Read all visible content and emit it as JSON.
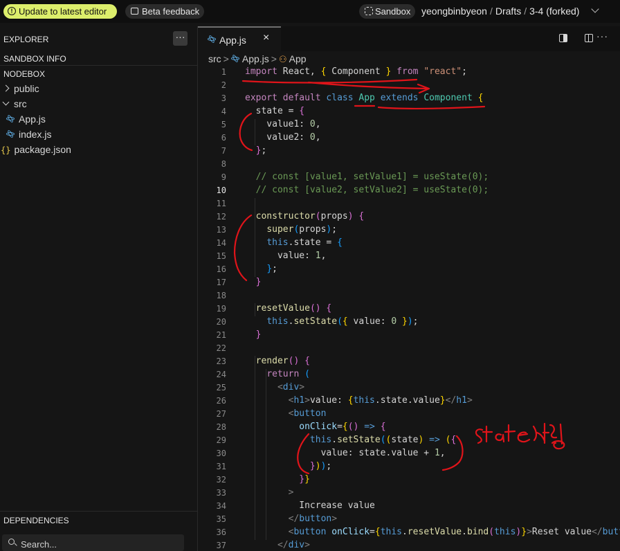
{
  "topbar": {
    "update_label": "Update to latest editor",
    "feedback_label": "Beta feedback",
    "sandbox_label": "Sandbox",
    "owner": "yeongbinbyeon",
    "folder": "Drafts",
    "project": "3-4 (forked)",
    "sep": "/"
  },
  "sidebar": {
    "explorer": "EXPLORER",
    "menu_dots": "···",
    "sandbox_info": "SANDBOX INFO",
    "nodebox": "NODEBOX",
    "tree": {
      "public": "public",
      "src": "src",
      "app": "App.js",
      "index": "index.js",
      "package": "package.json"
    },
    "json_icon": "{}",
    "dependencies": "DEPENDENCIES",
    "search_placeholder": "Search..."
  },
  "editor": {
    "tab_name": "App.js",
    "tab_close": "×",
    "more_dots": "···",
    "breadcrumb": {
      "src": "src",
      "file": "App.js",
      "symbol": "App",
      "sep": ">"
    },
    "active_line": 10,
    "lines": [
      [
        [
          "import",
          "#c586c0"
        ],
        [
          " React, ",
          null
        ],
        [
          "{",
          "#ffd700"
        ],
        [
          " Component ",
          null
        ],
        [
          "}",
          "#ffd700"
        ],
        [
          " ",
          null
        ],
        [
          "from",
          "#c586c0"
        ],
        [
          " ",
          null
        ],
        [
          "\"react\"",
          "#ce9178"
        ],
        [
          ";",
          null
        ]
      ],
      [],
      [
        [
          "export",
          "#c586c0"
        ],
        [
          " ",
          null
        ],
        [
          "default",
          "#c586c0"
        ],
        [
          " ",
          null
        ],
        [
          "class",
          "#569cd6"
        ],
        [
          " ",
          null
        ],
        [
          "App",
          "#4ec9b0"
        ],
        [
          " ",
          null
        ],
        [
          "extends",
          "#569cd6"
        ],
        [
          " ",
          null
        ],
        [
          "Component",
          "#4ec9b0"
        ],
        [
          " ",
          null
        ],
        [
          "{",
          "#ffd700"
        ]
      ],
      [
        [
          "  state = ",
          null
        ],
        [
          "{",
          "#da70d6"
        ]
      ],
      [
        [
          "    value1: ",
          null
        ],
        [
          "0",
          "#b5cea8"
        ],
        [
          ",",
          null
        ]
      ],
      [
        [
          "    value2: ",
          null
        ],
        [
          "0",
          "#b5cea8"
        ],
        [
          ",",
          null
        ]
      ],
      [
        [
          "  ",
          null
        ],
        [
          "}",
          "#da70d6"
        ],
        [
          ";",
          null
        ]
      ],
      [],
      [
        [
          "  // const [value1, setValue1] = useState(0);",
          "#6a9955"
        ]
      ],
      [
        [
          "  // const [value2, setValue2] = useState(0);",
          "#6a9955"
        ]
      ],
      [],
      [
        [
          "  ",
          null
        ],
        [
          "constructor",
          "#dcdcaa"
        ],
        [
          "(",
          "#da70d6"
        ],
        [
          "props",
          null
        ],
        [
          ")",
          "#da70d6"
        ],
        [
          " ",
          null
        ],
        [
          "{",
          "#da70d6"
        ]
      ],
      [
        [
          "    ",
          null
        ],
        [
          "super",
          "#dcdcaa"
        ],
        [
          "(",
          "#179fff"
        ],
        [
          "props",
          null
        ],
        [
          ")",
          "#179fff"
        ],
        [
          ";",
          null
        ]
      ],
      [
        [
          "    ",
          null
        ],
        [
          "this",
          "#569cd6"
        ],
        [
          ".state = ",
          null
        ],
        [
          "{",
          "#179fff"
        ]
      ],
      [
        [
          "      value: ",
          null
        ],
        [
          "1",
          "#b5cea8"
        ],
        [
          ",",
          null
        ]
      ],
      [
        [
          "    ",
          null
        ],
        [
          "}",
          "#179fff"
        ],
        [
          ";",
          null
        ]
      ],
      [
        [
          "  ",
          null
        ],
        [
          "}",
          "#da70d6"
        ]
      ],
      [],
      [
        [
          "  ",
          null
        ],
        [
          "resetValue",
          "#dcdcaa"
        ],
        [
          "()",
          "#da70d6"
        ],
        [
          " ",
          null
        ],
        [
          "{",
          "#da70d6"
        ]
      ],
      [
        [
          "    ",
          null
        ],
        [
          "this",
          "#569cd6"
        ],
        [
          ".",
          null
        ],
        [
          "setState",
          "#dcdcaa"
        ],
        [
          "(",
          "#179fff"
        ],
        [
          "{",
          "#ffd700"
        ],
        [
          " value: ",
          null
        ],
        [
          "0",
          "#b5cea8"
        ],
        [
          " ",
          null
        ],
        [
          "}",
          "#ffd700"
        ],
        [
          ")",
          "#179fff"
        ],
        [
          ";",
          null
        ]
      ],
      [
        [
          "  ",
          null
        ],
        [
          "}",
          "#da70d6"
        ]
      ],
      [],
      [
        [
          "  ",
          null
        ],
        [
          "render",
          "#dcdcaa"
        ],
        [
          "()",
          "#da70d6"
        ],
        [
          " ",
          null
        ],
        [
          "{",
          "#da70d6"
        ]
      ],
      [
        [
          "    ",
          null
        ],
        [
          "return",
          "#c586c0"
        ],
        [
          " ",
          null
        ],
        [
          "(",
          "#179fff"
        ]
      ],
      [
        [
          "      ",
          null
        ],
        [
          "<",
          "#808080"
        ],
        [
          "div",
          "#569cd6"
        ],
        [
          ">",
          "#808080"
        ]
      ],
      [
        [
          "        ",
          null
        ],
        [
          "<",
          "#808080"
        ],
        [
          "h1",
          "#569cd6"
        ],
        [
          ">",
          "#808080"
        ],
        [
          "value: ",
          null
        ],
        [
          "{",
          "#ffd700"
        ],
        [
          "this",
          "#569cd6"
        ],
        [
          ".state.value",
          null
        ],
        [
          "}",
          "#ffd700"
        ],
        [
          "</",
          "#808080"
        ],
        [
          "h1",
          "#569cd6"
        ],
        [
          ">",
          "#808080"
        ]
      ],
      [
        [
          "        ",
          null
        ],
        [
          "<",
          "#808080"
        ],
        [
          "button",
          "#569cd6"
        ]
      ],
      [
        [
          "          ",
          null
        ],
        [
          "onClick",
          "#9cdcfe"
        ],
        [
          "=",
          null
        ],
        [
          "{",
          "#ffd700"
        ],
        [
          "(",
          "#da70d6"
        ],
        [
          ")",
          "#da70d6"
        ],
        [
          " ",
          null
        ],
        [
          "=>",
          "#569cd6"
        ],
        [
          " ",
          null
        ],
        [
          "{",
          "#da70d6"
        ]
      ],
      [
        [
          "            ",
          null
        ],
        [
          "this",
          "#569cd6"
        ],
        [
          ".",
          null
        ],
        [
          "setState",
          "#dcdcaa"
        ],
        [
          "(",
          "#179fff"
        ],
        [
          "(",
          "#ffd700"
        ],
        [
          "state",
          null
        ],
        [
          ")",
          "#ffd700"
        ],
        [
          " ",
          null
        ],
        [
          "=>",
          "#569cd6"
        ],
        [
          " ",
          null
        ],
        [
          "(",
          "#ffd700"
        ],
        [
          "{",
          "#da70d6"
        ]
      ],
      [
        [
          "              value: state.value + ",
          null
        ],
        [
          "1",
          "#b5cea8"
        ],
        [
          ",",
          null
        ]
      ],
      [
        [
          "            ",
          null
        ],
        [
          "}",
          "#da70d6"
        ],
        [
          ")",
          "#ffd700"
        ],
        [
          ")",
          "#179fff"
        ],
        [
          ";",
          null
        ]
      ],
      [
        [
          "          ",
          null
        ],
        [
          "}",
          "#da70d6"
        ],
        [
          "}",
          "#ffd700"
        ]
      ],
      [
        [
          "        ",
          null
        ],
        [
          ">",
          "#808080"
        ]
      ],
      [
        [
          "          Increase value",
          null
        ]
      ],
      [
        [
          "        ",
          null
        ],
        [
          "</",
          "#808080"
        ],
        [
          "button",
          "#569cd6"
        ],
        [
          ">",
          "#808080"
        ]
      ],
      [
        [
          "        ",
          null
        ],
        [
          "<",
          "#808080"
        ],
        [
          "button",
          "#569cd6"
        ],
        [
          " ",
          null
        ],
        [
          "onClick",
          "#9cdcfe"
        ],
        [
          "=",
          null
        ],
        [
          "{",
          "#ffd700"
        ],
        [
          "this",
          "#569cd6"
        ],
        [
          ".",
          null
        ],
        [
          "resetValue",
          "#dcdcaa"
        ],
        [
          ".",
          null
        ],
        [
          "bind",
          "#dcdcaa"
        ],
        [
          "(",
          "#da70d6"
        ],
        [
          "this",
          "#569cd6"
        ],
        [
          ")",
          "#da70d6"
        ],
        [
          "}",
          "#ffd700"
        ],
        [
          ">",
          "#808080"
        ],
        [
          "Reset value",
          null
        ],
        [
          "</",
          "#808080"
        ],
        [
          "button",
          "#569cd6"
        ],
        [
          ">",
          "#808080"
        ]
      ],
      [
        [
          "      ",
          null
        ],
        [
          "</",
          "#808080"
        ],
        [
          "div",
          "#569cd6"
        ],
        [
          ">",
          "#808080"
        ]
      ]
    ]
  },
  "annotation": {
    "handwritten_text": "State 세팅",
    "ink_color": "#e0141a"
  }
}
